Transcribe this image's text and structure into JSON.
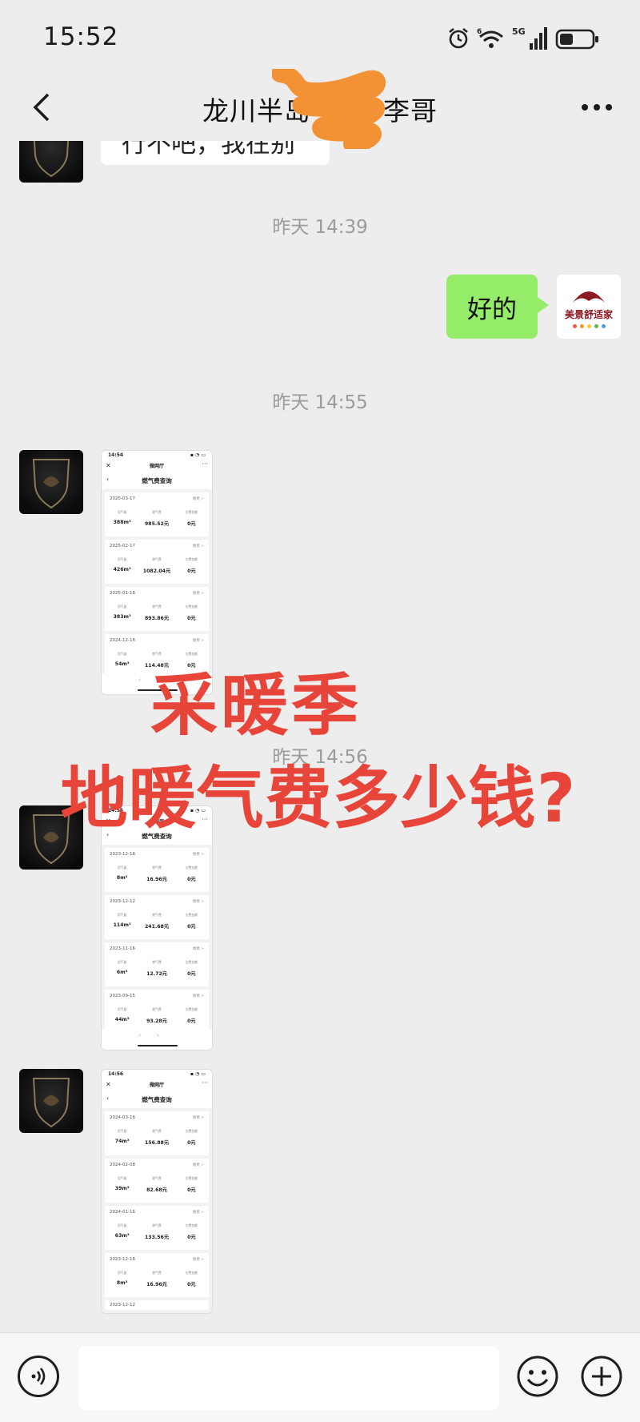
{
  "status_bar": {
    "time": "15:52",
    "icons": [
      "alarm-icon",
      "wifi-icon",
      "5g-signal-icon",
      "battery-icon"
    ],
    "network_label": "5G"
  },
  "nav": {
    "title": "龙川半岛 ···06李哥",
    "back_icon": "chevron-left-icon",
    "more_icon": "ellipsis-icon"
  },
  "messages": {
    "partial_text": "行不吧，我在别",
    "time_1": "昨天 14:39",
    "reply": "好的",
    "time_2": "昨天 14:55",
    "time_3": "昨天 14:56",
    "brand_name": "美景舒适家"
  },
  "screenshots": [
    {
      "status_time": "14:54",
      "app_name": "微网厅",
      "page_title": "燃气费查询",
      "labels": [
        "用气量",
        "燃气费",
        "欠费金额"
      ],
      "more_label": "缴费 >",
      "records": [
        {
          "date": "2025-03-17",
          "volume": "388m³",
          "fee": "985.52元",
          "owed": "0元"
        },
        {
          "date": "2025-02-17",
          "volume": "426m³",
          "fee": "1082.04元",
          "owed": "0元"
        },
        {
          "date": "2025-01-16",
          "volume": "383m³",
          "fee": "893.86元",
          "owed": "0元"
        },
        {
          "date": "2024-12-16",
          "volume": "54m³",
          "fee": "114.48元",
          "owed": "0元"
        }
      ]
    },
    {
      "status_time": "14:55",
      "app_name": "微网厅",
      "page_title": "燃气费查询",
      "labels": [
        "用气量",
        "燃气费",
        "欠费金额"
      ],
      "more_label": "缴费 >",
      "records": [
        {
          "date": "2023-12-16",
          "volume": "8m³",
          "fee": "16.96元",
          "owed": "0元"
        },
        {
          "date": "2023-12-12",
          "volume": "114m³",
          "fee": "241.68元",
          "owed": "0元"
        },
        {
          "date": "2023-11-16",
          "volume": "6m³",
          "fee": "12.72元",
          "owed": "0元"
        },
        {
          "date": "2023-09-15",
          "volume": "44m³",
          "fee": "93.28元",
          "owed": "0元"
        }
      ]
    },
    {
      "status_time": "14:56",
      "app_name": "微网厅",
      "page_title": "燃气费查询",
      "labels": [
        "用气量",
        "燃气费",
        "欠费金额"
      ],
      "more_label": "缴费 >",
      "records": [
        {
          "date": "2024-03-16",
          "volume": "74m³",
          "fee": "156.88元",
          "owed": "0元"
        },
        {
          "date": "2024-02-08",
          "volume": "39m³",
          "fee": "82.68元",
          "owed": "0元"
        },
        {
          "date": "2024-01-16",
          "volume": "63m³",
          "fee": "133.56元",
          "owed": "0元"
        },
        {
          "date": "2023-12-16",
          "volume": "8m³",
          "fee": "16.96元",
          "owed": "0元"
        }
      ],
      "tail_date": "2023-12-12"
    }
  ],
  "overlay": {
    "line1": "采暖季",
    "line2": "地暖气费多少钱?"
  },
  "colors": {
    "background": "#ededed",
    "bubble_green": "#95ec69",
    "overlay_red": "#e8453a",
    "scribble_orange": "#f39234"
  },
  "input_bar": {
    "placeholder": "",
    "icons": [
      "voice-icon",
      "emoji-icon",
      "plus-icon"
    ]
  }
}
